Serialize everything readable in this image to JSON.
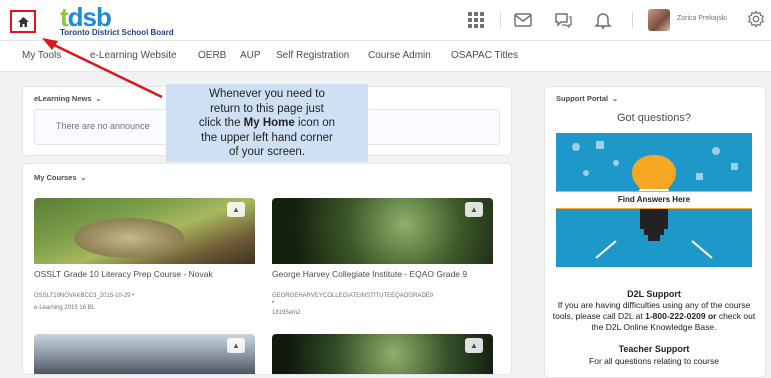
{
  "header": {
    "logo_text": "tdsb",
    "logo_subtitle": "Toronto District School Board",
    "user_name": "Zorica Prekajski"
  },
  "nav": {
    "items": [
      "My Tools",
      "e-Learning Website",
      "OERB",
      "AUP",
      "Self Registration",
      "Course Admin",
      "OSAPAC Titles"
    ]
  },
  "news": {
    "title": "eLearning News",
    "empty_text": "There are no announce"
  },
  "courses": {
    "title": "My Courses",
    "items": [
      {
        "title": "OSSLT Grade 10 Literacy Prep Course - Novak",
        "code": "OSSLT10NOVAKBCC3_2015-10-29",
        "meta": "e-Learning 2015 16 BL"
      },
      {
        "title": "George Harvey Collegiate Institute - EQAO Grade 9",
        "code": "GEORGEHARVEYCOLLEGIATEINSTITUTEEQAOGRADE9",
        "meta": "18195em2"
      }
    ]
  },
  "callout": {
    "line1": "Whenever you need to",
    "line2": "return to this page just",
    "line3_pre": "click the ",
    "line3_bold": "My Home",
    "line3_post": " icon on",
    "line4": "the upper left hand corner",
    "line5": "of your screen."
  },
  "support": {
    "portal_title": "Support Portal",
    "heading": "Got questions?",
    "banner": "Find Answers Here",
    "d2l_title": "D2L Support",
    "d2l_text_pre": "If you are having difficulties using any of the course tools, please call D2L at ",
    "d2l_phone": "1-800-222-0209 or",
    "d2l_text_post": " check out the D2L Online Knowledge Base.",
    "teacher_title": "Teacher Support",
    "teacher_text": "For all questions relating to course"
  },
  "colors": {
    "highlight": "#e0141e",
    "brand_blue": "#1a8cd8",
    "brand_green": "#8cc63f",
    "callout_bg": "#cfe0f4"
  }
}
